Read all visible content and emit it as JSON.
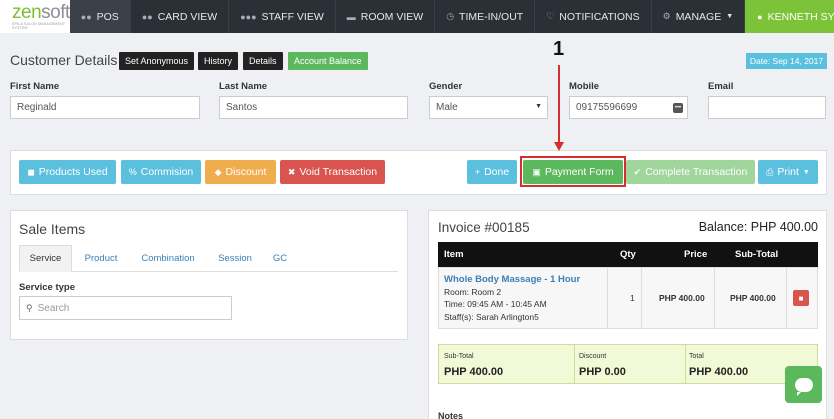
{
  "logo": {
    "part1": "zen",
    "part2": "soft",
    "tagline": "SPA & SALON MANAGEMENT SYSTEM"
  },
  "nav": {
    "items": [
      {
        "label": "POS",
        "icon": "users-icon"
      },
      {
        "label": "CARD VIEW",
        "icon": "users-icon"
      },
      {
        "label": "STAFF VIEW",
        "icon": "group-icon"
      },
      {
        "label": "ROOM VIEW",
        "icon": "bed-icon"
      },
      {
        "label": "TIME-IN/OUT",
        "icon": "clock-icon"
      },
      {
        "label": "NOTIFICATIONS",
        "icon": "bell-icon"
      },
      {
        "label": "MANAGE",
        "icon": "gear-icon"
      }
    ],
    "user": "KENNETH SYTIAN",
    "accent": "#7cc33a"
  },
  "customer": {
    "title": "Customer Details",
    "chips": [
      "Set Anonymous",
      "History",
      "Details",
      "Account Balance"
    ],
    "date": "Date: Sep 14, 2017",
    "fields": {
      "first_name": {
        "label": "First Name",
        "value": "Reginald"
      },
      "last_name": {
        "label": "Last Name",
        "value": "Santos"
      },
      "gender": {
        "label": "Gender",
        "value": "Male"
      },
      "mobile": {
        "label": "Mobile",
        "value": "09175596699"
      },
      "email": {
        "label": "Email",
        "value": ""
      }
    }
  },
  "actions": {
    "products_used": "Products Used",
    "commission": "Commision",
    "discount": "Discount",
    "void": "Void Transaction",
    "done": "Done",
    "payment_form": "Payment Form",
    "complete": "Complete Transaction",
    "print": "Print"
  },
  "annotation": {
    "number": "1",
    "color": "#d32f2f"
  },
  "sale": {
    "title": "Sale Items",
    "tabs": [
      "Service",
      "Product",
      "Combination",
      "Session",
      "GC"
    ],
    "service_type_label": "Service type",
    "search_placeholder": "Search"
  },
  "invoice": {
    "title": "Invoice #00185",
    "balance": "Balance: PHP 400.00",
    "headers": [
      "Item",
      "Qty",
      "Price",
      "Sub-Total"
    ],
    "rows": [
      {
        "name": "Whole Body Massage - 1 Hour",
        "room": "Room: Room 2",
        "time": "Time: 09:45 AM - 10:45 AM",
        "staff": "Staff(s): Sarah Arlington5",
        "qty": "1",
        "price": "PHP 400.00",
        "subtotal": "PHP 400.00"
      }
    ],
    "totals": [
      {
        "label": "Sub-Total",
        "value": "PHP 400.00"
      },
      {
        "label": "Discount",
        "value": "PHP 0.00"
      },
      {
        "label": "Total",
        "value": "PHP 400.00"
      }
    ],
    "notes_label": "Notes"
  }
}
